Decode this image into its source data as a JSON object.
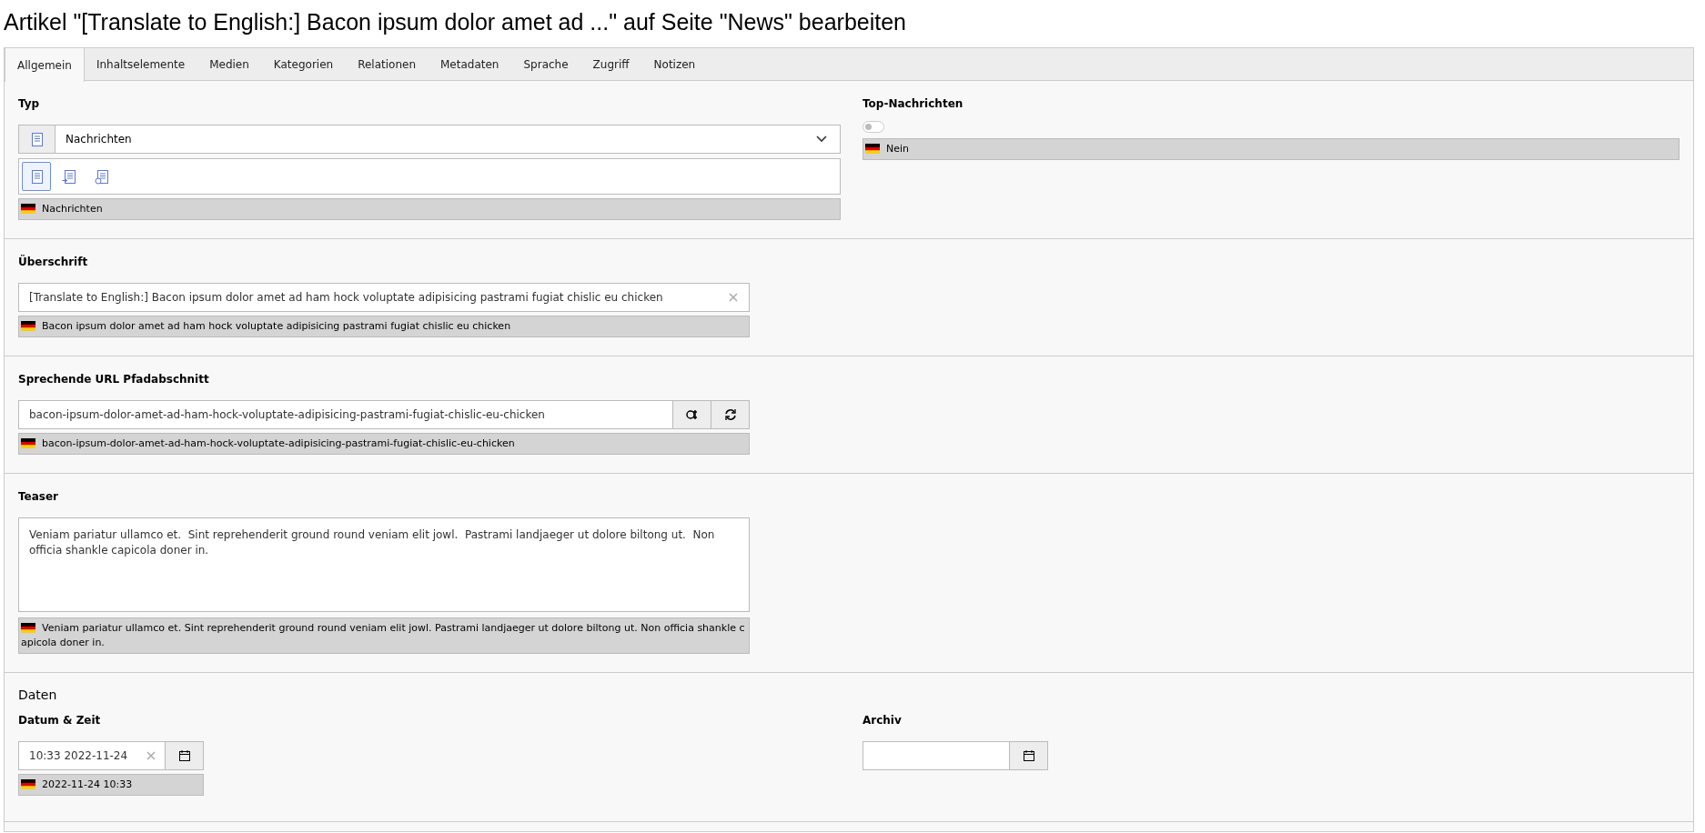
{
  "title": "Artikel \"[Translate to English:] Bacon ipsum dolor amet ad ...\" auf Seite \"News\" bearbeiten",
  "tabs": [
    {
      "label": "Allgemein",
      "selected": true
    },
    {
      "label": "Inhaltselemente",
      "selected": false
    },
    {
      "label": "Medien",
      "selected": false
    },
    {
      "label": "Kategorien",
      "selected": false
    },
    {
      "label": "Relationen",
      "selected": false
    },
    {
      "label": "Metadaten",
      "selected": false
    },
    {
      "label": "Sprache",
      "selected": false
    },
    {
      "label": "Zugriff",
      "selected": false
    },
    {
      "label": "Notizen",
      "selected": false
    }
  ],
  "type_field": {
    "label": "Typ",
    "value": "Nachrichten",
    "options": [
      {
        "kind": "news",
        "selected": true
      },
      {
        "kind": "internal",
        "selected": false
      },
      {
        "kind": "external",
        "selected": false
      }
    ],
    "default_value": "Nachrichten"
  },
  "top_news": {
    "label": "Top-Nachrichten",
    "on": false,
    "default_value": "Nein"
  },
  "headline": {
    "label": "Überschrift",
    "value": "[Translate to English:] Bacon ipsum dolor amet ad ham hock voluptate adipisicing pastrami fugiat chislic eu chicken",
    "default_value": "Bacon ipsum dolor amet ad ham hock voluptate adipisicing pastrami fugiat chislic eu chicken"
  },
  "path_segment": {
    "label": "Sprechende URL Pfadabschnitt",
    "value": "bacon-ipsum-dolor-amet-ad-ham-hock-voluptate-adipisicing-pastrami-fugiat-chislic-eu-chicken",
    "default_value": "bacon-ipsum-dolor-amet-ad-ham-hock-voluptate-adipisicing-pastrami-fugiat-chislic-eu-chicken"
  },
  "teaser": {
    "label": "Teaser",
    "value": "Veniam pariatur ullamco et.  Sint reprehenderit ground round veniam elit jowl.  Pastrami landjaeger ut dolore biltong ut.  Non officia shankle capicola doner in.",
    "default_value": "Veniam pariatur ullamco et. Sint reprehenderit ground round veniam elit jowl. Pastrami landjaeger ut dolore biltong ut. Non officia shankle capicola doner in."
  },
  "dates": {
    "heading": "Daten",
    "datetime": {
      "label": "Datum & Zeit",
      "value": "10:33 2022-11-24",
      "default_value": "2022-11-24 10:33"
    },
    "archive": {
      "label": "Archiv"
    }
  }
}
